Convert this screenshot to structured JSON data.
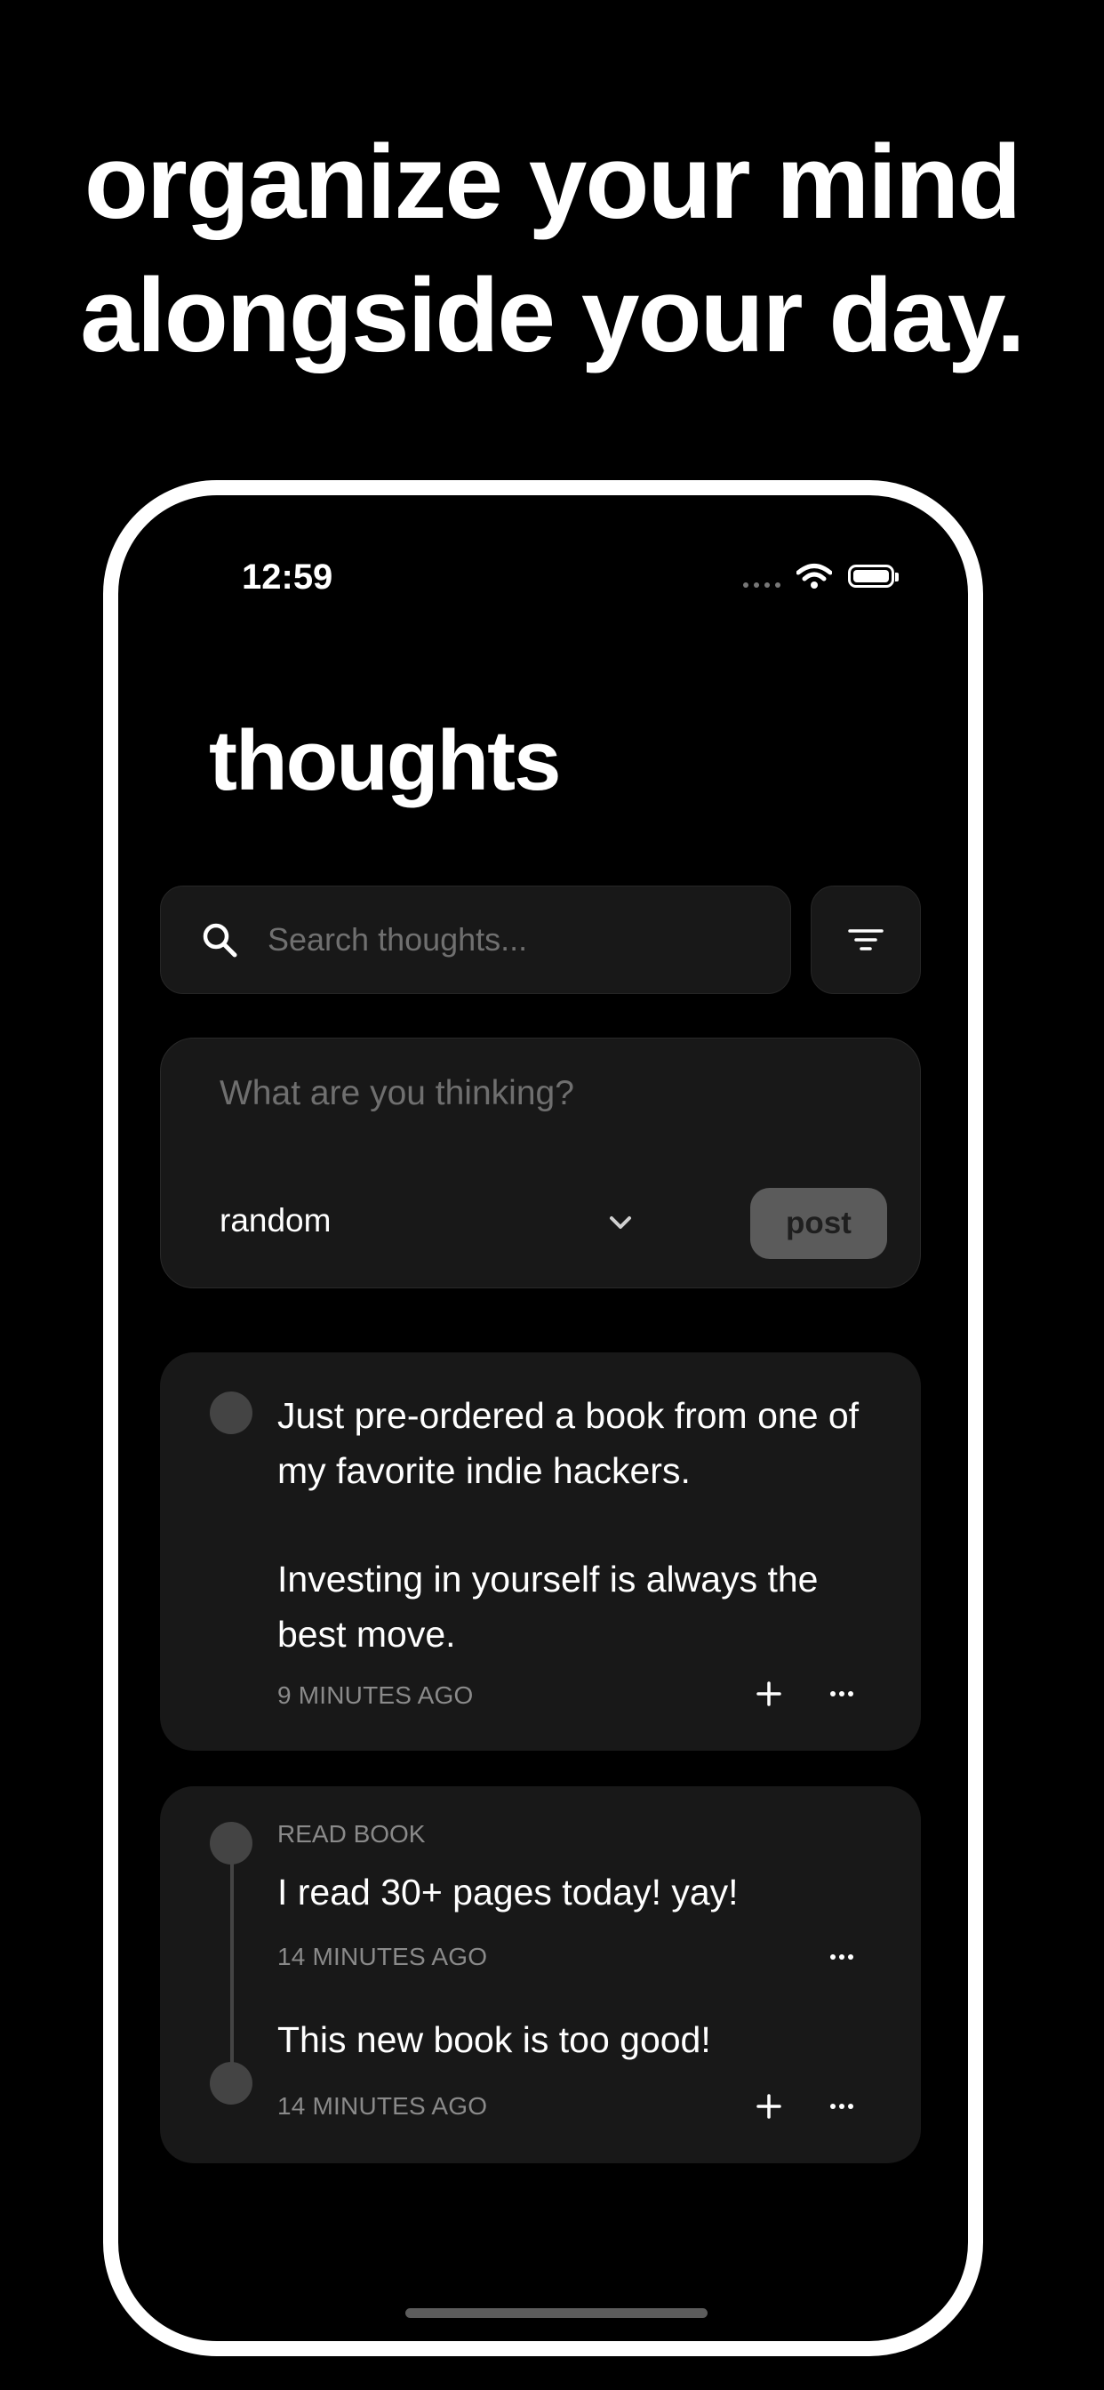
{
  "headline": {
    "line1": "organize your mind",
    "line2": "alongside your day."
  },
  "status_bar": {
    "time": "12:59"
  },
  "page": {
    "title": "thoughts"
  },
  "search": {
    "placeholder": "Search thoughts..."
  },
  "composer": {
    "placeholder": "What are you thinking?",
    "category": "random",
    "post_label": "post"
  },
  "thoughts": [
    {
      "paragraph1": "Just pre-ordered a book from one of my favorite indie hackers.",
      "paragraph2": "Investing in yourself is always the best move.",
      "time": "9 MINUTES AGO"
    }
  ],
  "thread": {
    "tag": "READ BOOK",
    "entries": [
      {
        "text": "I read 30+ pages today! yay!",
        "time": "14 MINUTES AGO"
      },
      {
        "text": "This new book is too good!",
        "time": "14 MINUTES AGO"
      }
    ]
  },
  "colors": {
    "background": "#000000",
    "card": "#181818",
    "muted_text": "#8a8a8a",
    "post_button": "#5b5b5b"
  },
  "icons": [
    "search-icon",
    "filter-icon",
    "chevron-down-icon",
    "plus-icon",
    "more-icon",
    "wifi-icon",
    "battery-icon"
  ]
}
